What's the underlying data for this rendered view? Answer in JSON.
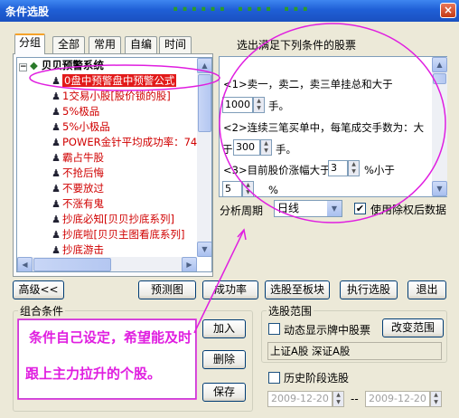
{
  "window": {
    "title": "条件选股",
    "title_deco": "...... .... ...",
    "close_glyph": "×"
  },
  "tabs": [
    "分组",
    "全部",
    "常用",
    "自编",
    "时间"
  ],
  "tree": {
    "root": "贝贝预警系统",
    "items": [
      "0盘中预警盘中预警公式",
      "1交易小股[股价锁的股]",
      "5%极品",
      "5%小极品",
      "POWER金针平均成功率：74.",
      "霸占牛股",
      "不抢后悔",
      "不要放过",
      "不涨有鬼",
      "抄底必知[贝贝抄底系列]",
      "抄底啦[贝贝主图看底系列]",
      "抄底游击"
    ]
  },
  "conditions": {
    "header": "选出满足下列条件的股票",
    "c1_text": "<1>卖一，卖二，卖三单挂总和大于",
    "c1_value": "1000",
    "c1_unit": "手。",
    "c2_text": "<2>连续三笔买单中，每笔成交手数为：大",
    "c2_prefix": "于",
    "c2_value": "300",
    "c2_unit": "手。",
    "c3_text": "<3>目前股价涨幅大于",
    "c3_value": "3",
    "c3_mid": "%小于",
    "c3_value2": "5",
    "c3_unit": "%"
  },
  "period": {
    "label": "分析周期",
    "value": "日线"
  },
  "use_adjusted": {
    "label": "使用除权后数据",
    "checked": "✔"
  },
  "buttons": {
    "advanced": "高级<<",
    "preview": "预测图",
    "success_rate": "成功率",
    "to_block": "选股至板块",
    "execute": "执行选股",
    "exit": "退出",
    "add": "加入",
    "delete": "删除",
    "save": "保存",
    "change_range": "改变范围"
  },
  "combo": {
    "label": "组合条件"
  },
  "range": {
    "label": "选股范围",
    "dynamic_label": "动态显示牌中股票",
    "markets": "上证A股 深证A股",
    "history_label": "历史阶段选股",
    "date_from": "2009-12-20",
    "date_to": "2009-12-20",
    "date_sep": "--"
  },
  "annotation": {
    "line1": "条件自己设定，希望能及时",
    "line2": "跟上主力拉升的个股。",
    "color": "#e01ee0"
  }
}
